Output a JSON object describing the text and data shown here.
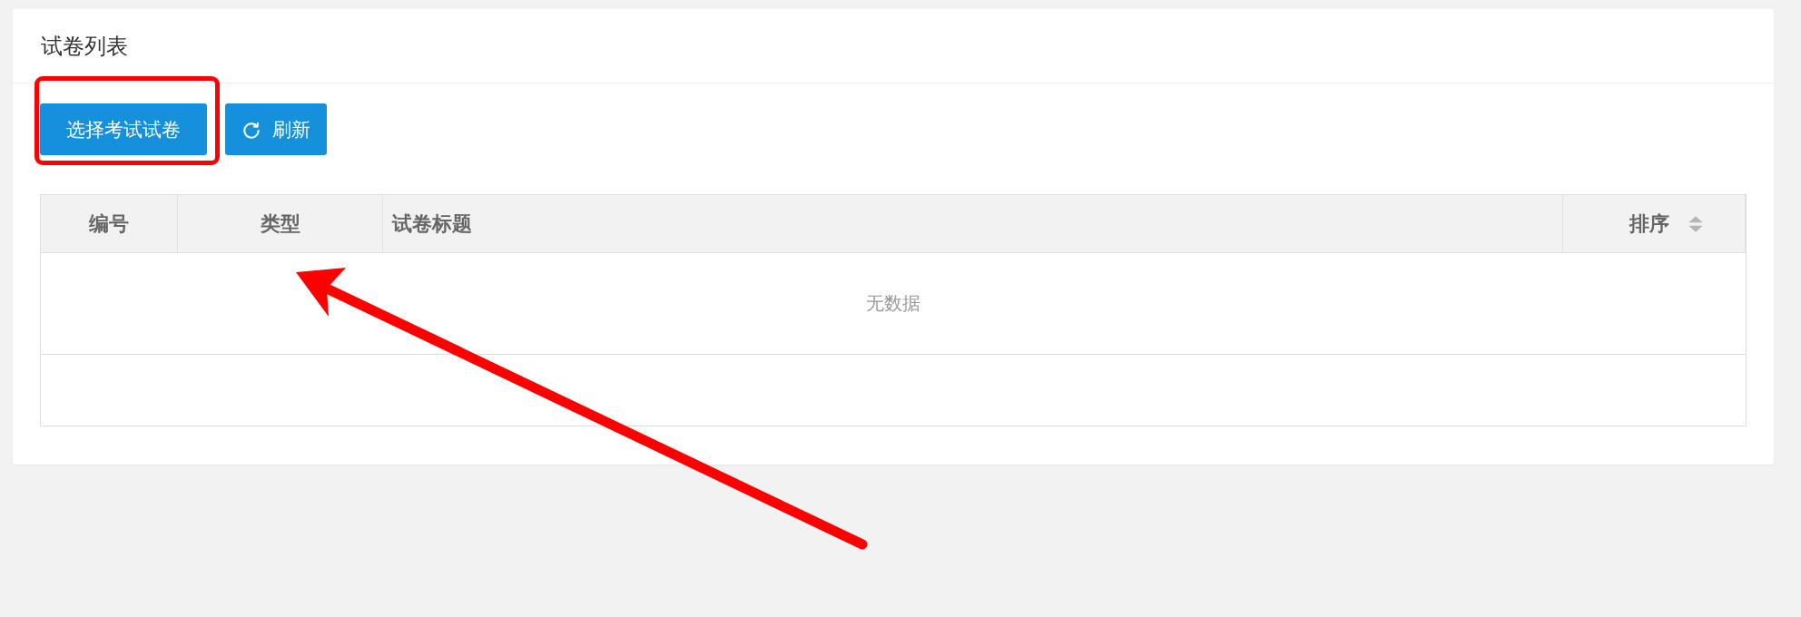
{
  "panel": {
    "title": "试卷列表"
  },
  "toolbar": [
    {
      "label": "选择考试试卷",
      "kind": "plain"
    },
    {
      "label": "刷新",
      "kind": "refresh"
    }
  ],
  "table": {
    "columns": [
      {
        "label": "编号",
        "sortable": false
      },
      {
        "label": "类型",
        "sortable": false
      },
      {
        "label": "试卷标题",
        "sortable": false
      },
      {
        "label": "排序",
        "sortable": true
      }
    ],
    "empty_text": "无数据"
  }
}
